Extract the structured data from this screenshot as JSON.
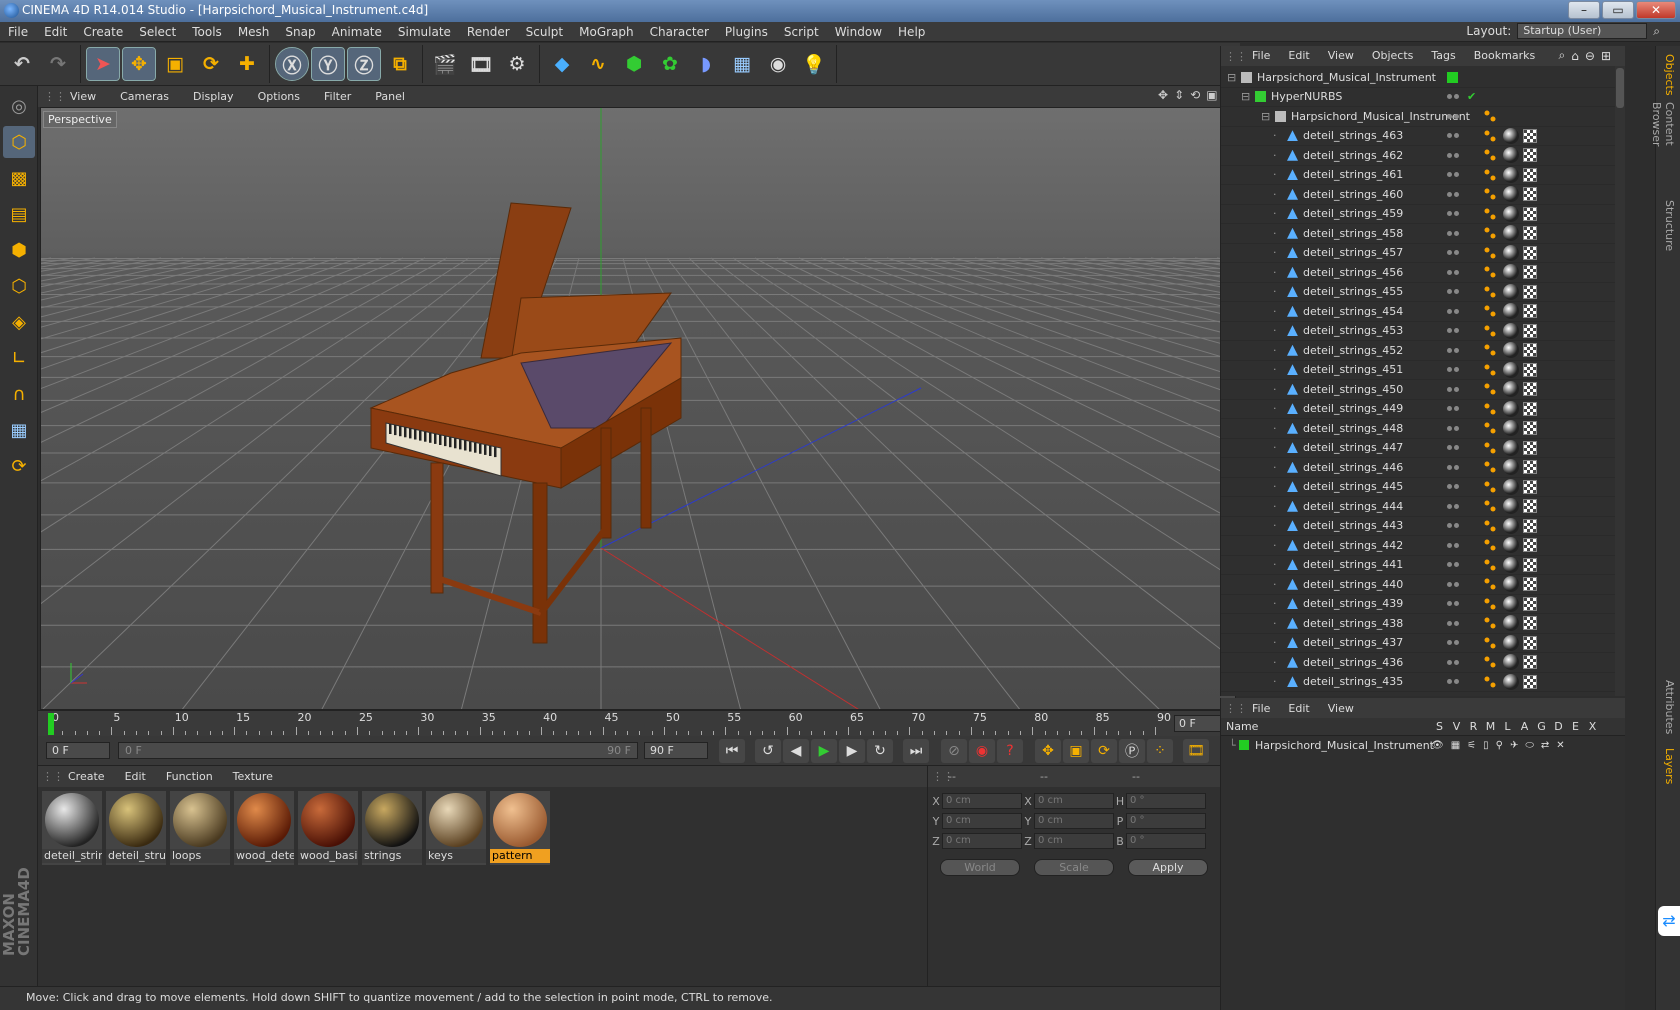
{
  "window": {
    "title": "CINEMA 4D R14.014 Studio - [Harpsichord_Musical_Instrument.c4d]",
    "min": "–",
    "max": "▭",
    "close": "✕"
  },
  "menu": [
    "File",
    "Edit",
    "Create",
    "Select",
    "Tools",
    "Mesh",
    "Snap",
    "Animate",
    "Simulate",
    "Render",
    "Sculpt",
    "MoGraph",
    "Character",
    "Plugins",
    "Script",
    "Window",
    "Help"
  ],
  "layout": {
    "label": "Layout:",
    "value": "Startup (User)"
  },
  "viewport": {
    "menu": [
      "View",
      "Cameras",
      "Display",
      "Options",
      "Filter",
      "Panel"
    ],
    "label": "Perspective"
  },
  "timeline": {
    "ticks": [
      "0",
      "5",
      "10",
      "15",
      "20",
      "25",
      "30",
      "35",
      "40",
      "45",
      "50",
      "55",
      "60",
      "65",
      "70",
      "75",
      "80",
      "85",
      "90"
    ],
    "frame": "0 F"
  },
  "transport": {
    "start": "0 F",
    "slider_start": "0 F",
    "slider_end": "90 F",
    "end": "90 F"
  },
  "materials": {
    "menu": [
      "Create",
      "Edit",
      "Function",
      "Texture"
    ],
    "items": [
      {
        "name": "deteil_strin",
        "c1": "#e8e8e8",
        "c2": "#222"
      },
      {
        "name": "deteil_strui",
        "c1": "#d8c27a",
        "c2": "#3a2a10"
      },
      {
        "name": "loops",
        "c1": "#d8c290",
        "c2": "#4a3a20"
      },
      {
        "name": "wood_dete",
        "c1": "#e08a4a",
        "c2": "#5a1a05"
      },
      {
        "name": "wood_basi",
        "c1": "#c86a3a",
        "c2": "#4a1005"
      },
      {
        "name": "strings",
        "c1": "#c8a860",
        "c2": "#111"
      },
      {
        "name": "keys",
        "c1": "#e8d8b8",
        "c2": "#5a4020"
      },
      {
        "name": "pattern",
        "c1": "#f0c090",
        "c2": "#9a5a30"
      }
    ],
    "selected": 7
  },
  "coords": {
    "header": [
      "--",
      "--",
      "--"
    ],
    "rows": [
      {
        "a": "X",
        "av": "0 cm",
        "b": "X",
        "bv": "0 cm",
        "c": "H",
        "cv": "0 °"
      },
      {
        "a": "Y",
        "av": "0 cm",
        "b": "Y",
        "bv": "0 cm",
        "c": "P",
        "cv": "0 °"
      },
      {
        "a": "Z",
        "av": "0 cm",
        "b": "Z",
        "bv": "0 cm",
        "c": "B",
        "cv": "0 °"
      }
    ],
    "world": "World",
    "scale": "Scale",
    "apply": "Apply"
  },
  "status": "Move: Click and drag to move elements. Hold down SHIFT to quantize movement / add to the selection in point mode, CTRL to remove.",
  "objects": {
    "menu": [
      "File",
      "Edit",
      "View",
      "Objects",
      "Tags",
      "Bookmarks"
    ],
    "root": "Harpsichord_Musical_Instrument",
    "nurbs": "HyperNURBS",
    "group": "Harpsichord_Musical_Instrument",
    "strings": [
      "deteil_strings_463",
      "deteil_strings_462",
      "deteil_strings_461",
      "deteil_strings_460",
      "deteil_strings_459",
      "deteil_strings_458",
      "deteil_strings_457",
      "deteil_strings_456",
      "deteil_strings_455",
      "deteil_strings_454",
      "deteil_strings_453",
      "deteil_strings_452",
      "deteil_strings_451",
      "deteil_strings_450",
      "deteil_strings_449",
      "deteil_strings_448",
      "deteil_strings_447",
      "deteil_strings_446",
      "deteil_strings_445",
      "deteil_strings_444",
      "deteil_strings_443",
      "deteil_strings_442",
      "deteil_strings_441",
      "deteil_strings_440",
      "deteil_strings_439",
      "deteil_strings_438",
      "deteil_strings_437",
      "deteil_strings_436",
      "deteil_strings_435"
    ]
  },
  "layers": {
    "menu": [
      "File",
      "Edit",
      "View"
    ],
    "cols": [
      "Name",
      "S",
      "V",
      "R",
      "M",
      "L",
      "A",
      "G",
      "D",
      "E",
      "X"
    ],
    "row": "Harpsichord_Musical_Instrument"
  },
  "side_tabs": [
    "Objects",
    "Content Browser",
    "Structure",
    "Attributes",
    "Layers"
  ],
  "colors": {
    "accent": "#f0a020",
    "green": "#22cc22",
    "wood": "#8a3e12"
  }
}
